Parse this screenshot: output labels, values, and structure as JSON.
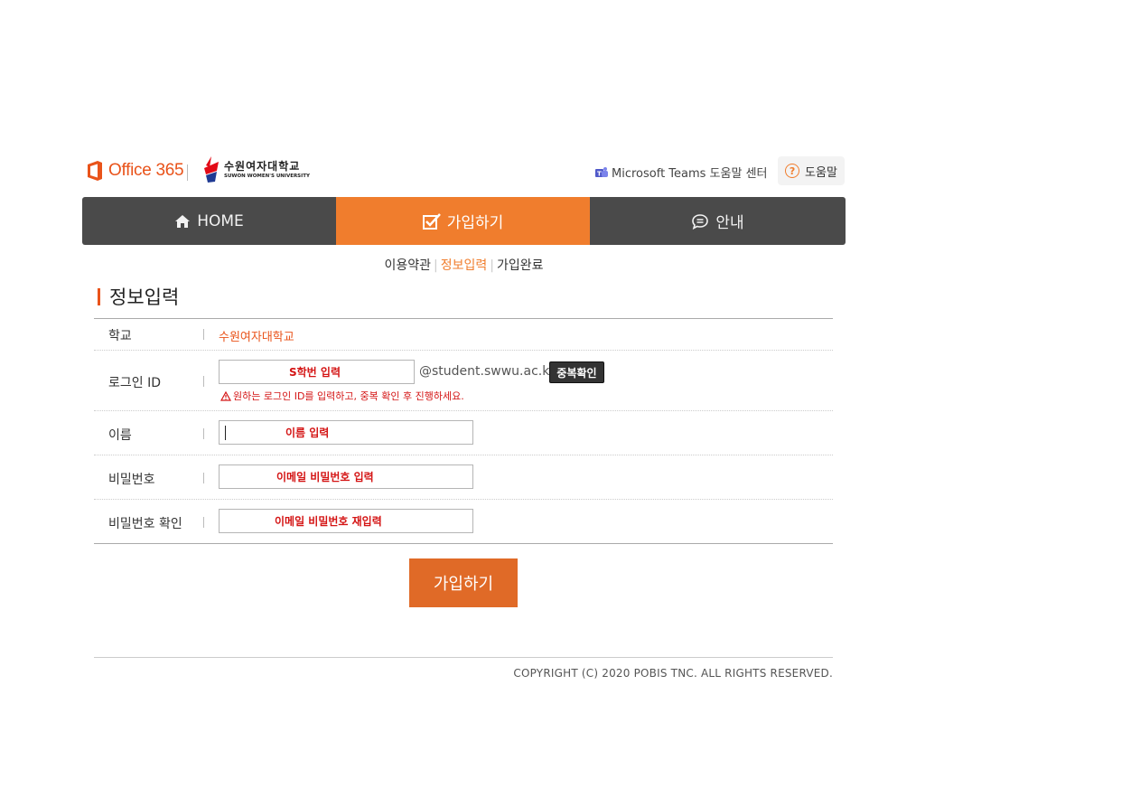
{
  "header": {
    "office_logo_text": "Office 365",
    "univ_name_ko": "수원여자대학교",
    "univ_name_en": "SUWON WOMEN'S UNIVERSITY",
    "teams_link": "Microsoft Teams 도움말 센터",
    "help_label": "도움말",
    "help_icon_text": "?"
  },
  "nav": {
    "tabs": [
      {
        "label": "HOME",
        "icon": "home-icon"
      },
      {
        "label": "가입하기",
        "icon": "checkbox-icon",
        "active": true
      },
      {
        "label": "안내",
        "icon": "chat-icon"
      }
    ]
  },
  "steps": {
    "items": [
      "이용약관",
      "정보입력",
      "가입완료"
    ],
    "separator": "|",
    "current": "정보입력"
  },
  "section": {
    "title": "정보입력"
  },
  "form": {
    "school": {
      "label": "학교",
      "value": "수원여자대학교"
    },
    "login_id": {
      "label": "로그인 ID",
      "placeholder": "S학번 입력",
      "domain": "@student.swwu.ac.kr",
      "check_button": "중복확인",
      "warning": "원하는 로그인 ID를 입력하고, 중복 확인 후 진행하세요."
    },
    "name": {
      "label": "이름",
      "placeholder": "이름 입력"
    },
    "password": {
      "label": "비밀번호",
      "placeholder": "이메일 비밀번호 입력"
    },
    "password_confirm": {
      "label": "비밀번호 확인",
      "placeholder": "이메일 비밀번호 재입력"
    }
  },
  "submit_label": "가입하기",
  "footer": {
    "copyright": "COPYRIGHT (C) 2020 POBIS TNC. ALL RIGHTS RESERVED."
  },
  "colors": {
    "accent": "#f07d2d",
    "nav_bg": "#4a4a4a",
    "submit": "#e06a27",
    "warning": "#d41414",
    "brand": "#e9531a"
  }
}
